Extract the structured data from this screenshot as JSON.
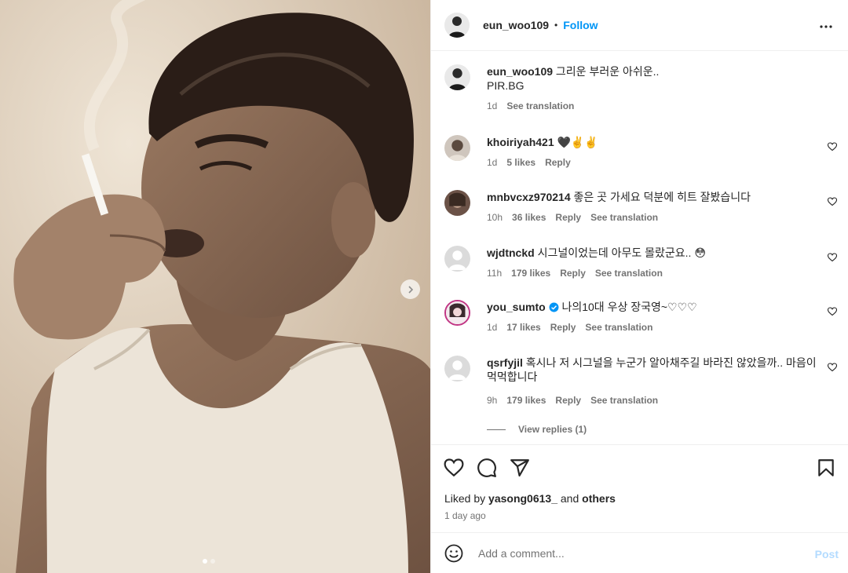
{
  "post": {
    "author": "eun_woo109",
    "header_separator": "•",
    "follow_label": "Follow",
    "caption_line1": "그리운 부러운 아쉬운..",
    "caption_line2": "PIR.BG",
    "caption_time": "1d",
    "caption_translate": "See translation"
  },
  "comments": [
    {
      "user": "khoiriyah421",
      "text": "🖤✌️✌️",
      "time": "1d",
      "likes": "5 likes",
      "reply": "Reply",
      "translate": "",
      "verified": false
    },
    {
      "user": "mnbvcxz970214",
      "text": "좋은 곳 가세요 덕분에 히트 잘봤습니다",
      "time": "10h",
      "likes": "36 likes",
      "reply": "Reply",
      "translate": "See translation",
      "verified": false
    },
    {
      "user": "wjdtnckd",
      "text": "시그널이었는데 아무도 몰랐군요.. 😳",
      "time": "11h",
      "likes": "179 likes",
      "reply": "Reply",
      "translate": "See translation",
      "verified": false
    },
    {
      "user": "you_sumto",
      "text": "나의10대 우상 장국영~♡♡♡",
      "time": "1d",
      "likes": "17 likes",
      "reply": "Reply",
      "translate": "See translation",
      "verified": true
    },
    {
      "user": "qsrfyjil",
      "text": "혹시나 저 시그널을 누군가 알아채주길 바라진 않았을까.. 마음이 먹먹합니다",
      "time": "9h",
      "likes": "179 likes",
      "reply": "Reply",
      "translate": "See translation",
      "verified": false
    }
  ],
  "view_replies": "View replies (1)",
  "likes_prefix": "Liked by",
  "likes_user": "yasong0613_",
  "likes_and": "and",
  "likes_others": "others",
  "post_age": "1 day ago",
  "add_comment": {
    "placeholder": "Add a comment...",
    "post_label": "Post"
  },
  "colors": {
    "accent": "#0095f6",
    "post_disabled": "#b3dbff",
    "muted": "#737373",
    "verified": "#0095f6"
  },
  "icons": [
    "more-icon",
    "heart-icon",
    "comment-icon",
    "share-icon",
    "bookmark-icon",
    "emoji-icon",
    "chevron-right-icon"
  ],
  "carousel": {
    "slide_count": 2,
    "active_slide": 1
  }
}
